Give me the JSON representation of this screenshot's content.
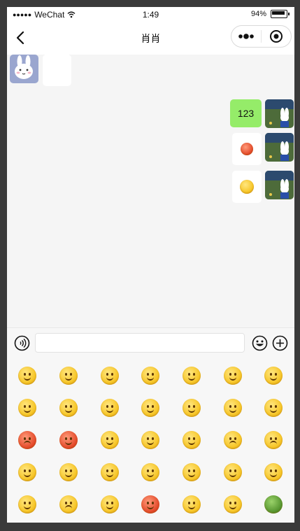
{
  "status_bar": {
    "signal_dots": "●●●●●",
    "carrier": "WeChat",
    "time": "1:49",
    "battery_percent": "94%"
  },
  "nav": {
    "title": "肖肖"
  },
  "messages": [
    {
      "side": "left",
      "type": "blank",
      "text": ""
    },
    {
      "side": "right",
      "type": "text",
      "text": "123"
    },
    {
      "side": "right",
      "type": "emoji",
      "icon": "blush-emoji"
    },
    {
      "side": "right",
      "type": "emoji",
      "icon": "grimace-emoji"
    }
  ],
  "input": {
    "value": "",
    "placeholder": ""
  },
  "emoji_panel": {
    "icons": [
      "smile",
      "grin",
      "grimace",
      "slight-smile",
      "shy",
      "heart-eyes",
      "surprised",
      "cool",
      "shocked",
      "blush",
      "dizzy",
      "sleepy",
      "cry",
      "stare",
      "angry",
      "furious",
      "relieved",
      "big-grin",
      "hand-over-mouth",
      "sad",
      "glare",
      "flushed",
      "tongue",
      "kiss",
      "tears",
      "thinking",
      "happy",
      "whistle",
      "puzzled",
      "worried",
      "blank",
      "mad-red",
      "smirk",
      "toothy",
      "turtle"
    ]
  },
  "colors": {
    "bubble_sent": "#95ec69",
    "bubble_received": "#ffffff",
    "chat_bg": "#f5f5f5"
  }
}
